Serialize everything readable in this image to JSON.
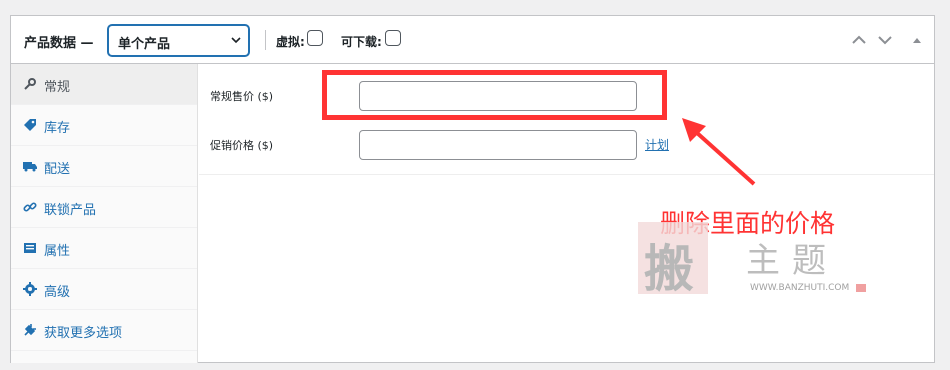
{
  "header": {
    "title": "产品数据 —",
    "product_type": "单个产品",
    "virtual_label": "虚拟:",
    "downloadable_label": "可下载:"
  },
  "sidebar": {
    "tabs": [
      {
        "label": "常规",
        "icon": "wrench-icon"
      },
      {
        "label": "库存",
        "icon": "tag-icon"
      },
      {
        "label": "配送",
        "icon": "truck-icon"
      },
      {
        "label": "联锁产品",
        "icon": "link-icon"
      },
      {
        "label": "属性",
        "icon": "list-icon"
      },
      {
        "label": "高级",
        "icon": "gear-icon"
      },
      {
        "label": "获取更多选项",
        "icon": "plugin-icon"
      }
    ]
  },
  "main": {
    "regular_price_label": "常规售价 ($)",
    "regular_price_value": "",
    "sale_price_label": "促销价格 ($)",
    "sale_price_value": "",
    "schedule_link": "计划"
  },
  "annotation": {
    "text": "删除里面的价格",
    "color": "#ff3333"
  },
  "watermark": {
    "seal_char": "搬",
    "text": "主题",
    "url": "WWW.BANZHUTI.COM"
  },
  "colors": {
    "accent": "#2271b1",
    "highlight": "#ff3333"
  }
}
